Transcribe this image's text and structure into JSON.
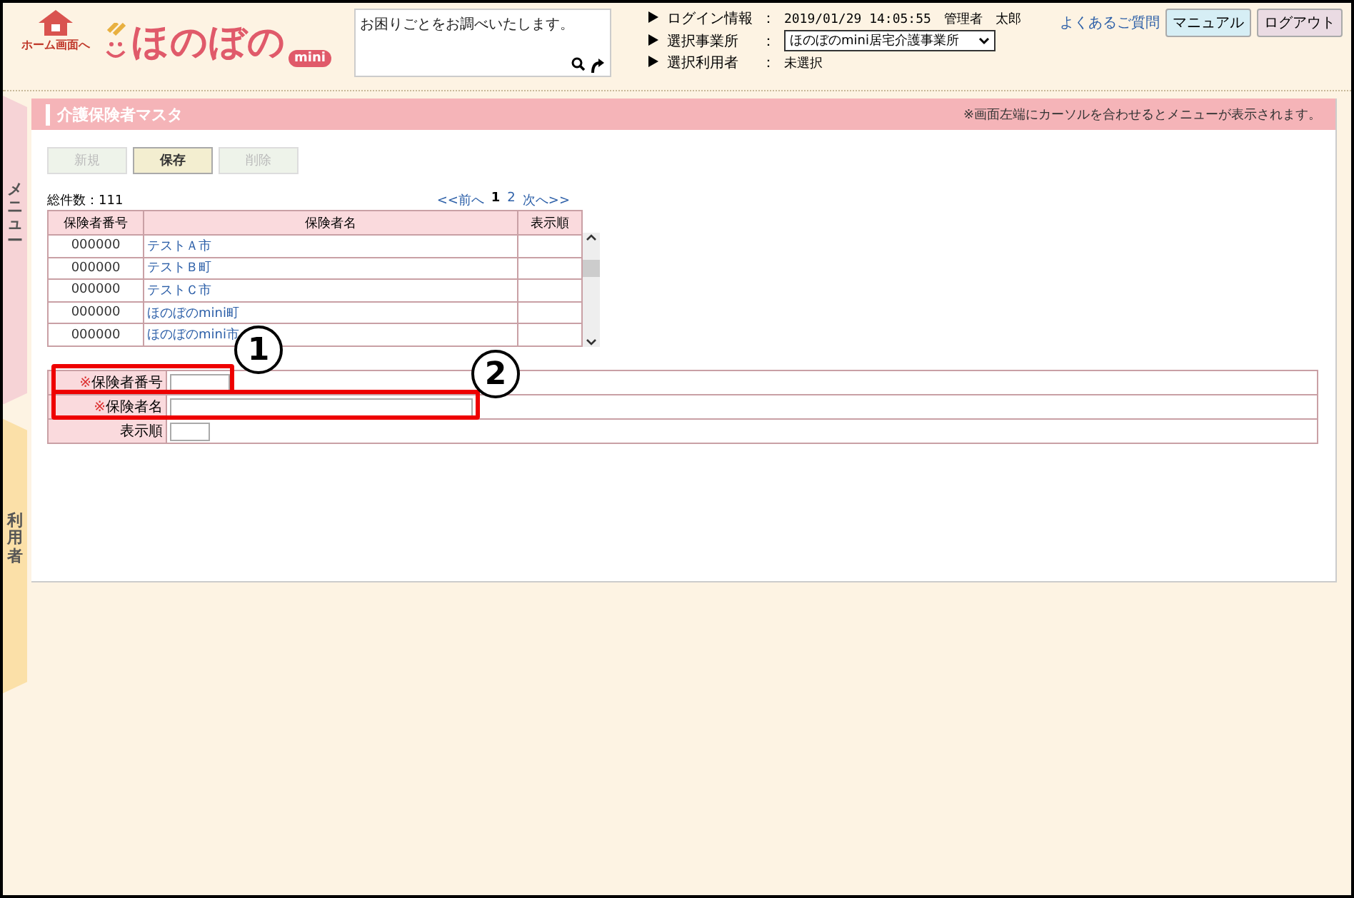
{
  "header": {
    "home_label": "ホーム画面へ",
    "logo": "ほのぼの",
    "logo_badge": "mini",
    "search": {
      "placeholder": "お困りごとをお調べいたします。"
    },
    "info": [
      {
        "label": "ログイン情報",
        "sep": "：",
        "kind": "text",
        "value": "2019/01/29 14:05:55　管理者　太郎"
      },
      {
        "label": "選択事業所",
        "sep": "：",
        "kind": "select",
        "value": "ほのぼのmini居宅介護事業所"
      },
      {
        "label": "選択利用者",
        "sep": "：",
        "kind": "text",
        "value": "未選択"
      }
    ],
    "faq_link": "よくあるご質問",
    "buttons": [
      {
        "label": "マニュアル",
        "kind": "manual"
      },
      {
        "label": "ログアウト",
        "kind": "logout"
      }
    ]
  },
  "side_tabs": [
    {
      "label": "メニュー",
      "kind": "menu"
    },
    {
      "label": "利用者",
      "kind": "user"
    }
  ],
  "panel": {
    "title": "介護保険者マスタ",
    "notice": "※画面左端にカーソルを合わせるとメニューが表示されます。",
    "actions": [
      {
        "label": "新規",
        "disabled": true
      },
      {
        "label": "保存",
        "disabled": false
      },
      {
        "label": "削除",
        "disabled": true
      }
    ],
    "total": "総件数：111",
    "pager": [
      {
        "label": "<<前へ",
        "selected": false
      },
      {
        "label": "1",
        "selected": true
      },
      {
        "label": "2",
        "selected": false
      },
      {
        "label": "次へ>>",
        "selected": false
      }
    ],
    "table": {
      "columns": [
        "保険者番号",
        "保険者名",
        "表示順"
      ],
      "rows": [
        [
          "000000",
          "テストＡ市",
          ""
        ],
        [
          "000000",
          "テストＢ町",
          ""
        ],
        [
          "000000",
          "テストＣ市",
          ""
        ],
        [
          "000000",
          "ほのぼのmini町",
          ""
        ],
        [
          "000000",
          "ほのぼのmini市",
          ""
        ]
      ]
    },
    "form": [
      {
        "label": "保険者番号",
        "required": true,
        "mark": "※",
        "kind": "short"
      },
      {
        "label": "保険者名",
        "required": true,
        "mark": "※",
        "kind": "long"
      },
      {
        "label": "表示順",
        "kind": "tiny"
      }
    ]
  },
  "annotations": [
    "1",
    "2"
  ]
}
